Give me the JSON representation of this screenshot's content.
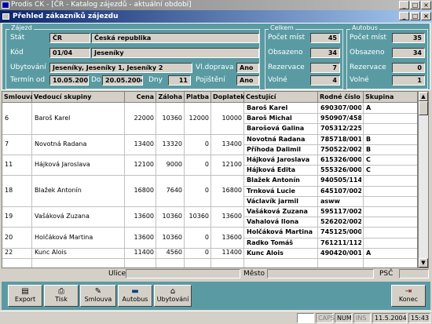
{
  "window": {
    "title": "Prodis CK - [ČR - Katalog zájezdů - aktuální období]"
  },
  "form": {
    "title": "Přehled zákazníků zájezdu"
  },
  "zajezd": {
    "group_label": "Zájezd",
    "stat_label": "Stát",
    "stat_code": "ČR",
    "stat_name": "Česká republika",
    "kod_label": "Kód",
    "kod_code": "01/04",
    "kod_name": "Jeseníky",
    "ubyt_label": "Ubytování",
    "ubyt_value": "Jeseníky, Jeseníky 1, Jeseníky 2",
    "vldoprava_label": "Vl.doprava",
    "vldoprava_value": "Ano",
    "termin_label": "Termín od",
    "termin_od": "10.05.2004",
    "do_label": "Do",
    "termin_do": "20.05.2004",
    "dny_label": "Dny",
    "dny_value": "11",
    "pojisteni_label": "Pojištění",
    "pojisteni_value": "Ano"
  },
  "celkem": {
    "group_label": "Celkem",
    "rows": [
      {
        "label": "Počet míst",
        "value": "45"
      },
      {
        "label": "Obsazeno",
        "value": "34"
      },
      {
        "label": "Rezervace",
        "value": "7"
      },
      {
        "label": "Volné",
        "value": "4"
      }
    ]
  },
  "autobus": {
    "group_label": "Autobus",
    "rows": [
      {
        "label": "Počet míst",
        "value": "35"
      },
      {
        "label": "Obsazeno",
        "value": "34"
      },
      {
        "label": "Rezervace",
        "value": "0"
      },
      {
        "label": "Volné",
        "value": "1"
      }
    ]
  },
  "grid": {
    "headers": [
      "Smlouva",
      "Vedoucí skupiny",
      "Cena",
      "Záloha",
      "Platba",
      "Doplatek",
      "Cestující",
      "Rodné číslo",
      "Skupina"
    ],
    "contracts": [
      {
        "id": "6",
        "leader": "Baroš Karel",
        "cena": "22000",
        "zaloha": "10360",
        "platba": "12000",
        "doplatek": "10000"
      },
      {
        "id": "7",
        "leader": "Novotná Radana",
        "cena": "13400",
        "zaloha": "13320",
        "platba": "0",
        "doplatek": "13400"
      },
      {
        "id": "11",
        "leader": "Hájková Jaroslava",
        "cena": "12100",
        "zaloha": "9000",
        "platba": "0",
        "doplatek": "12100"
      },
      {
        "id": "18",
        "leader": "Blažek Antonín",
        "cena": "16800",
        "zaloha": "7640",
        "platba": "0",
        "doplatek": "16800"
      },
      {
        "id": "19",
        "leader": "Vašáková Zuzana",
        "cena": "13600",
        "zaloha": "10360",
        "platba": "10360",
        "doplatek": "13600"
      },
      {
        "id": "20",
        "leader": "Holčáková Martina",
        "cena": "13600",
        "zaloha": "10360",
        "platba": "0",
        "doplatek": "13600"
      },
      {
        "id": "22",
        "leader": "Kunc Alois",
        "cena": "11400",
        "zaloha": "4560",
        "platba": "0",
        "doplatek": "11400"
      }
    ],
    "passengers": [
      {
        "name": "Baroš Karel",
        "rc": "690307/0001",
        "sk": "A"
      },
      {
        "name": "Baroš Michal",
        "rc": "950907/4587",
        "sk": ""
      },
      {
        "name": "Barošová Galina",
        "rc": "705312/2254",
        "sk": ""
      },
      {
        "name": "Novotná Radana",
        "rc": "785718/0019",
        "sk": "B"
      },
      {
        "name": "Příhoda Dalimil",
        "rc": "750522/0020",
        "sk": "B"
      },
      {
        "name": "Hájková Jaroslava",
        "rc": "615326/0005",
        "sk": "C"
      },
      {
        "name": "Hájková Edita",
        "rc": "555326/0006",
        "sk": "C"
      },
      {
        "name": "Blažek Antonín",
        "rc": "940505/1147",
        "sk": ""
      },
      {
        "name": "Trnková Lucie",
        "rc": "645107/0023",
        "sk": ""
      },
      {
        "name": "Václavík jarmil",
        "rc": "asww",
        "sk": ""
      },
      {
        "name": "Vašáková Zuzana",
        "rc": "595117/0025",
        "sk": ""
      },
      {
        "name": "Vahalová Ilona",
        "rc": "526202/0024",
        "sk": ""
      },
      {
        "name": "Holčáková Martina",
        "rc": "745125/0008",
        "sk": ""
      },
      {
        "name": "Radko Tomáš",
        "rc": "761211/1122",
        "sk": ""
      },
      {
        "name": "Kunc Alois",
        "rc": "490420/0016",
        "sk": "A"
      }
    ]
  },
  "address": {
    "ulice": "Ulice",
    "mesto": "Město",
    "psc": "PSČ"
  },
  "buttons": {
    "export": "Export",
    "tisk": "Tisk",
    "smlouva": "Smlouva",
    "autobus": "Autobus",
    "ubytovani": "Ubytování",
    "konec": "Konec"
  },
  "statusbar": {
    "caps": "CAPS",
    "num": "NUM",
    "ins": "INS",
    "date": "11.5.2004",
    "time": "15:43"
  }
}
